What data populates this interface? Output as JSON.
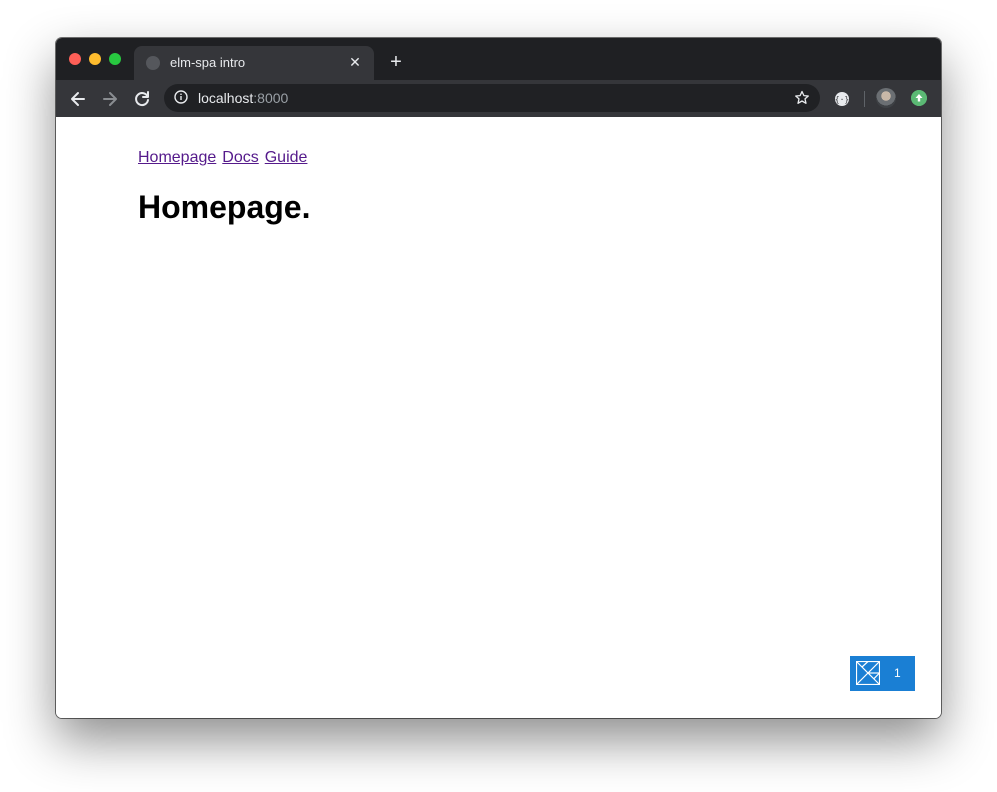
{
  "browser": {
    "tab": {
      "title": "elm-spa intro",
      "close_glyph": "✕"
    },
    "new_tab_glyph": "+",
    "omnibox": {
      "host": "localhost",
      "port": ":8000"
    },
    "icons": {
      "back": "arrow-left-icon",
      "forward": "arrow-right-icon",
      "reload": "reload-icon",
      "info": "info-icon",
      "bookmark": "star-icon",
      "extension": "extension-icon",
      "update": "update-icon"
    }
  },
  "page": {
    "nav": [
      {
        "label": "Homepage"
      },
      {
        "label": "Docs"
      },
      {
        "label": "Guide"
      }
    ],
    "title": "Homepage."
  },
  "debugger_badge": {
    "count": "1",
    "color": "#1a7fd4"
  }
}
